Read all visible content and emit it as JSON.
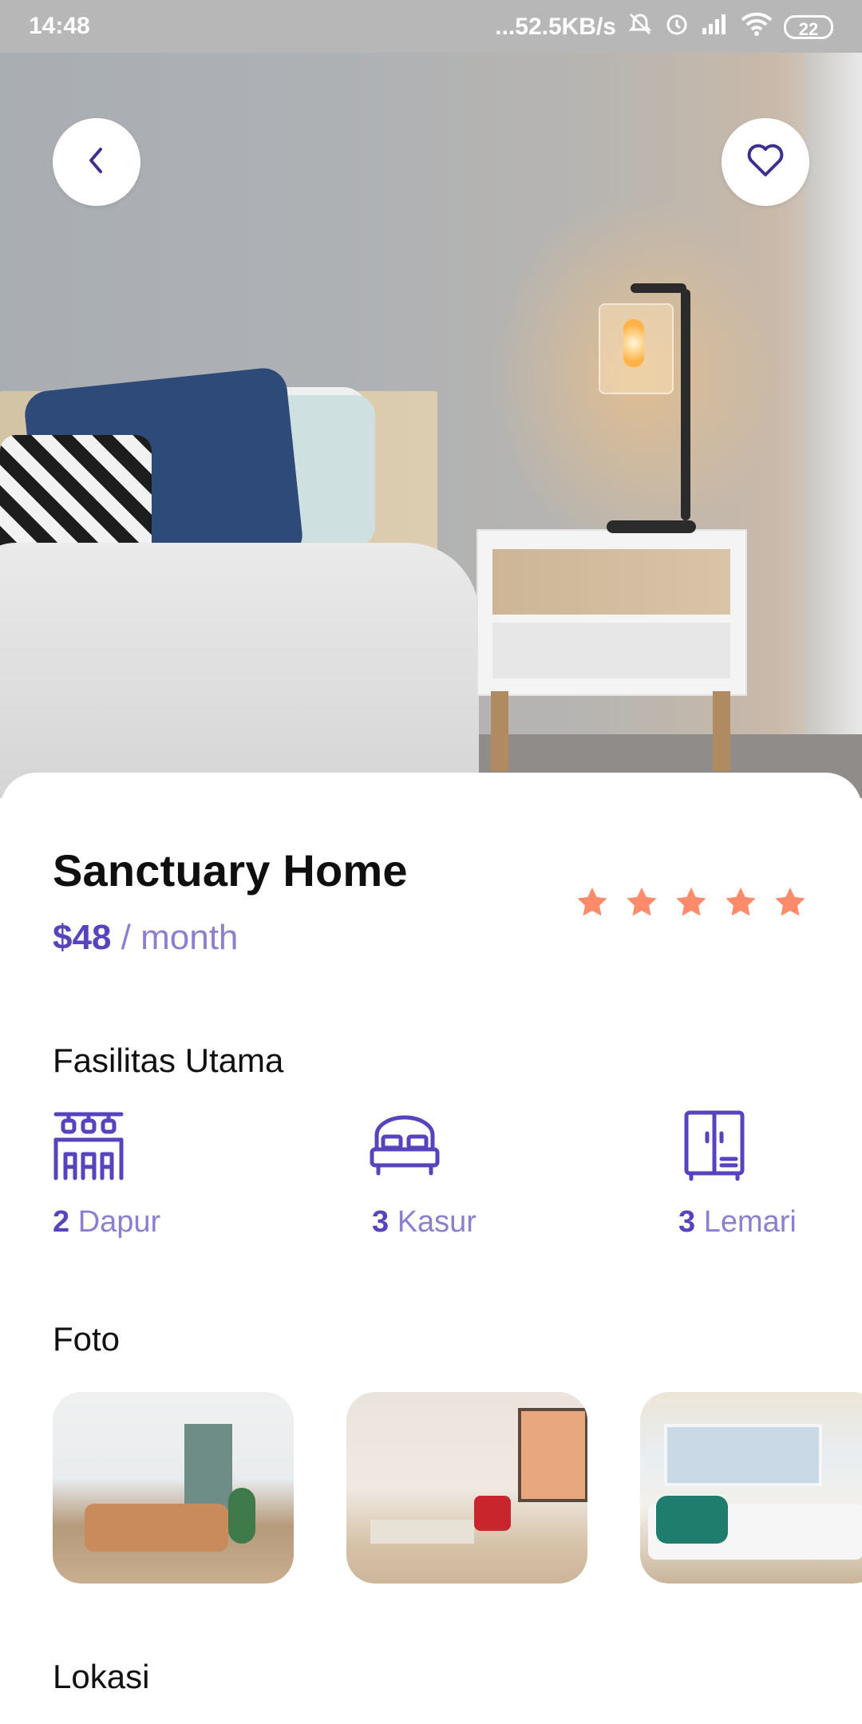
{
  "status_bar": {
    "time": "14:48",
    "network_speed": "...52.5KB/s",
    "battery": "22",
    "icons": [
      "mute-icon",
      "alarm-icon",
      "signal-icon",
      "wifi-icon",
      "battery-icon"
    ]
  },
  "hero": {
    "image_alt": "bedroom-photo",
    "back_icon": "chevron-left-icon",
    "favorite_icon": "heart-icon"
  },
  "listing": {
    "title": "Sanctuary Home",
    "price": "$48",
    "price_unit": " / month",
    "rating": 5,
    "rating_max": 5
  },
  "facilities": {
    "heading": "Fasilitas Utama",
    "items": [
      {
        "count": "2",
        "label": " Dapur",
        "icon": "kitchen-icon"
      },
      {
        "count": "3",
        "label": " Kasur",
        "icon": "bed-icon"
      },
      {
        "count": "3",
        "label": " Lemari",
        "icon": "wardrobe-icon"
      }
    ]
  },
  "photos": {
    "heading": "Foto",
    "items": [
      "living-room-photo",
      "dining-room-photo",
      "bedroom-photo"
    ]
  },
  "location": {
    "heading": "Lokasi"
  },
  "colors": {
    "primary": "#5843be",
    "primary_light": "#8b7fd0",
    "star": "#ff8b6b"
  }
}
